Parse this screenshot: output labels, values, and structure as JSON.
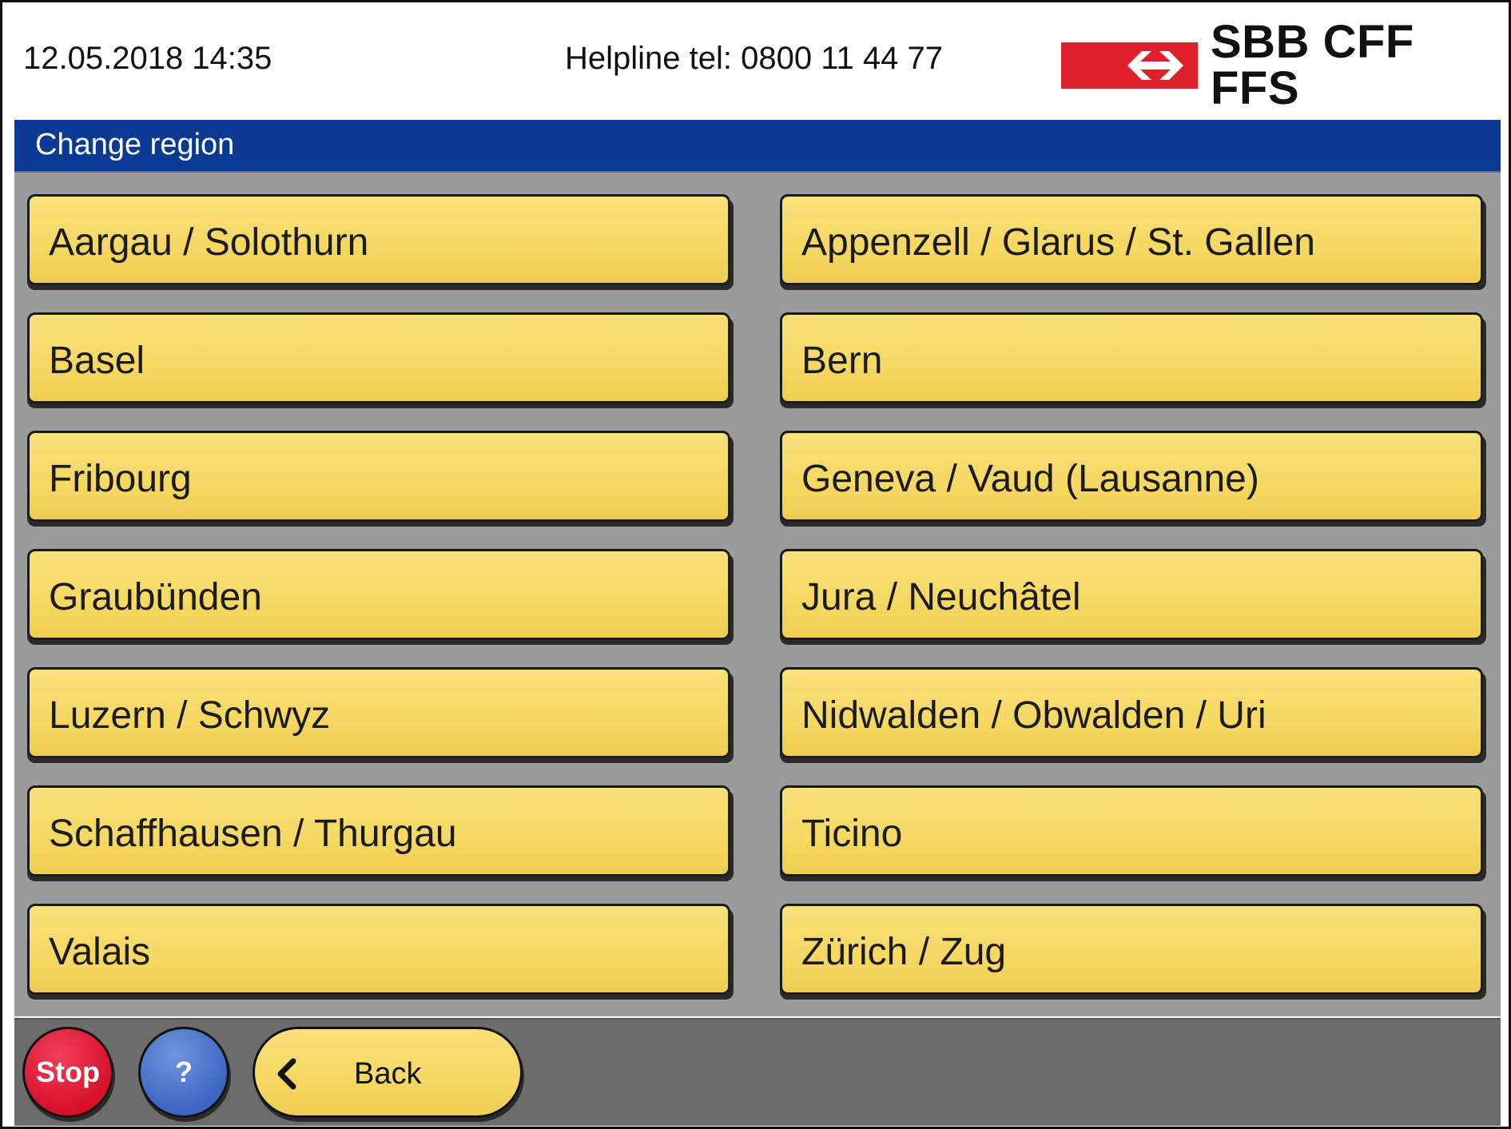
{
  "header": {
    "datetime": "12.05.2018 14:35",
    "helpline": "Helpline tel: 0800 11 44 77",
    "logo_text": "SBB CFF FFS"
  },
  "title": "Change region",
  "regions": [
    "Aargau / Solothurn",
    "Appenzell / Glarus / St. Gallen",
    "Basel",
    "Bern",
    "Fribourg",
    "Geneva / Vaud (Lausanne)",
    "Graubünden",
    "Jura / Neuchâtel",
    "Luzern / Schwyz",
    "Nidwalden / Obwalden / Uri",
    "Schaffhausen / Thurgau",
    "Ticino",
    "Valais",
    "Zürich / Zug"
  ],
  "footer": {
    "stop_label": "Stop",
    "help_label": "?",
    "back_label": "Back"
  },
  "colors": {
    "title_bar": "#0b3a94",
    "button_yellow": "#f6d862",
    "stop_red": "#d8102a",
    "help_blue": "#3b67c2",
    "sbb_red": "#e0202b"
  },
  "icons": {
    "logo": "sbb-swiss-railways-logo",
    "back": "chevron-left-icon"
  }
}
